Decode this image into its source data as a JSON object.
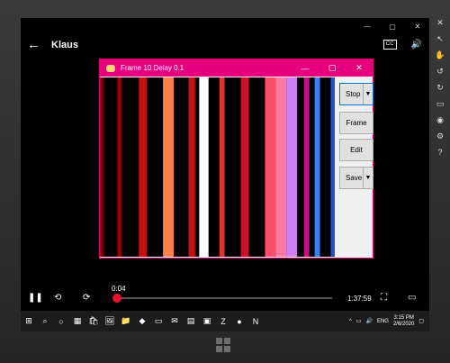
{
  "app": {
    "title": "Klaus",
    "cc_label": "CC"
  },
  "window_controls": {
    "minimize": "—",
    "restore": "▢",
    "close": "✕"
  },
  "gif_window": {
    "title": "Frame 10 Delay 0.1",
    "buttons": {
      "stop": "Stop",
      "frame": "Frame",
      "edit": "Edit",
      "save": "Save"
    },
    "stripes": [
      {
        "c": "#7a0000",
        "w": 3
      },
      {
        "c": "#000",
        "w": 10
      },
      {
        "c": "#a00000",
        "w": 3
      },
      {
        "c": "#000",
        "w": 13
      },
      {
        "c": "#c31010",
        "w": 6
      },
      {
        "c": "#000",
        "w": 12
      },
      {
        "c": "#ff7f4a",
        "w": 8
      },
      {
        "c": "#000",
        "w": 11
      },
      {
        "c": "#c31010",
        "w": 5
      },
      {
        "c": "#000",
        "w": 3
      },
      {
        "c": "#ffffff",
        "w": 7
      },
      {
        "c": "#000",
        "w": 8
      },
      {
        "c": "#e33030",
        "w": 4
      },
      {
        "c": "#000",
        "w": 12
      },
      {
        "c": "#cc0f24",
        "w": 6
      },
      {
        "c": "#000",
        "w": 12
      },
      {
        "c": "#ff4d6a",
        "w": 8
      },
      {
        "c": "#ff7aa3",
        "w": 8
      },
      {
        "c": "#cc80ff",
        "w": 8
      },
      {
        "c": "#000",
        "w": 5
      },
      {
        "c": "#c3127f",
        "w": 4
      },
      {
        "c": "#000",
        "w": 4
      },
      {
        "c": "#3b7dff",
        "w": 4
      },
      {
        "c": "#000",
        "w": 8
      },
      {
        "c": "#1e52cc",
        "w": 3
      }
    ]
  },
  "player": {
    "elapsed": "0:04",
    "duration": "1:37:59",
    "progress": 0.002
  },
  "taskbar": {
    "lang": "ENG",
    "time": "3:15 PM",
    "date": "2/6/2020"
  },
  "colors": {
    "accent": "#e6007e",
    "seek": "#e8112d"
  }
}
